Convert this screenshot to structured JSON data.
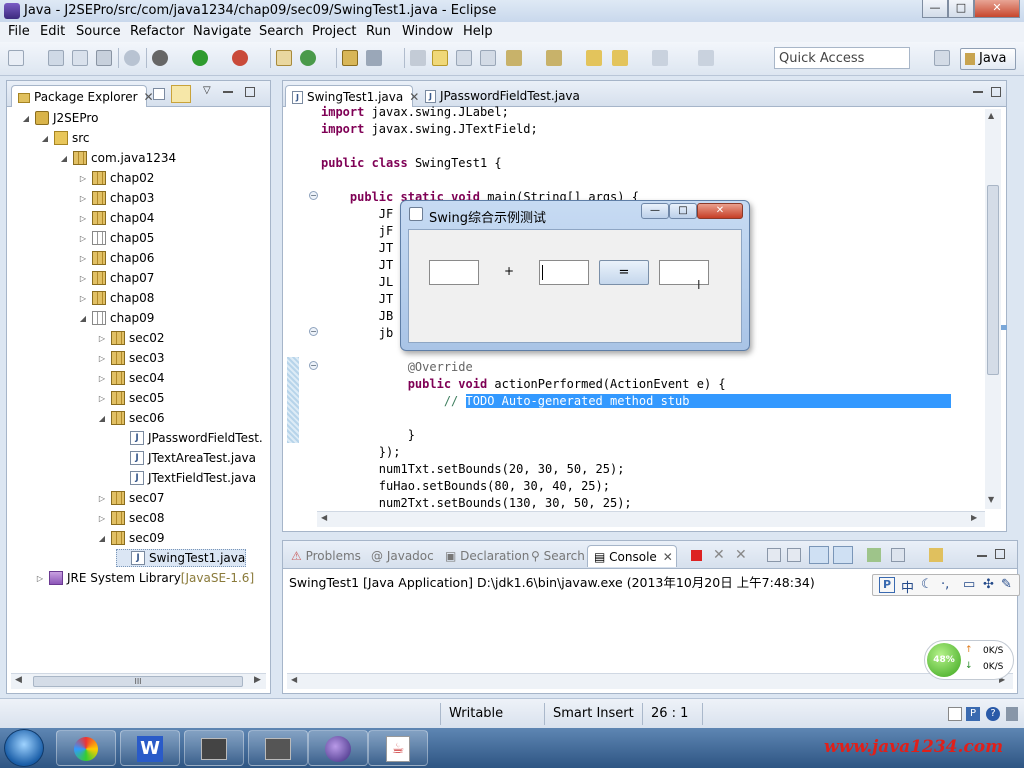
{
  "window": {
    "title": "Java - J2SEPro/src/com/java1234/chap09/sec09/SwingTest1.java - Eclipse",
    "min": "—",
    "max": "□",
    "close": "✕"
  },
  "menubar": [
    "File",
    "Edit",
    "Source",
    "Refactor",
    "Navigate",
    "Search",
    "Project",
    "Run",
    "Window",
    "Help"
  ],
  "toolbar": {
    "quick_access_placeholder": "Quick Access",
    "perspective": "Java"
  },
  "package_explorer": {
    "title": "Package Explorer",
    "tree": [
      {
        "label": "J2SEPro",
        "indent": 0,
        "icon": "project-icon",
        "expanded": true
      },
      {
        "label": "src",
        "indent": 1,
        "icon": "source-folder-icon",
        "expanded": true
      },
      {
        "label": "com.java1234",
        "indent": 2,
        "icon": "package-icon",
        "expanded": true
      },
      {
        "label": "chap02",
        "indent": 3,
        "icon": "package-icon",
        "expanded": false
      },
      {
        "label": "chap03",
        "indent": 3,
        "icon": "package-icon",
        "expanded": false
      },
      {
        "label": "chap04",
        "indent": 3,
        "icon": "package-icon",
        "expanded": false
      },
      {
        "label": "chap05",
        "indent": 3,
        "icon": "package-empty-icon",
        "expanded": false
      },
      {
        "label": "chap06",
        "indent": 3,
        "icon": "package-icon",
        "expanded": false
      },
      {
        "label": "chap07",
        "indent": 3,
        "icon": "package-icon",
        "expanded": false
      },
      {
        "label": "chap08",
        "indent": 3,
        "icon": "package-icon",
        "expanded": false
      },
      {
        "label": "chap09",
        "indent": 3,
        "icon": "package-empty-icon",
        "expanded": true
      },
      {
        "label": "sec02",
        "indent": 4,
        "icon": "package-icon",
        "expanded": false
      },
      {
        "label": "sec03",
        "indent": 4,
        "icon": "package-icon",
        "expanded": false
      },
      {
        "label": "sec04",
        "indent": 4,
        "icon": "package-icon",
        "expanded": false
      },
      {
        "label": "sec05",
        "indent": 4,
        "icon": "package-icon",
        "expanded": false
      },
      {
        "label": "sec06",
        "indent": 4,
        "icon": "package-icon",
        "expanded": true
      },
      {
        "label": "JPasswordFieldTest.",
        "indent": 5,
        "icon": "java-file-icon",
        "leaf": true
      },
      {
        "label": "JTextAreaTest.java",
        "indent": 5,
        "icon": "java-file-icon",
        "leaf": true
      },
      {
        "label": "JTextFieldTest.java",
        "indent": 5,
        "icon": "java-file-icon",
        "leaf": true
      },
      {
        "label": "sec07",
        "indent": 4,
        "icon": "package-icon",
        "expanded": false
      },
      {
        "label": "sec08",
        "indent": 4,
        "icon": "package-icon",
        "expanded": false
      },
      {
        "label": "sec09",
        "indent": 4,
        "icon": "package-icon",
        "expanded": true
      },
      {
        "label": "SwingTest1.java",
        "indent": 5,
        "icon": "java-file-icon",
        "leaf": true,
        "selected": true
      },
      {
        "label": "JRE System Library",
        "suffix": " [JavaSE-1.6]",
        "indent": 1,
        "icon": "library-icon",
        "expanded": false
      }
    ],
    "scroll_label": "III"
  },
  "editor": {
    "tabs": [
      "SwingTest1.java",
      "JPasswordFieldTest.java"
    ],
    "code_lines": [
      "import javax.swing.JLabel;",
      "import javax.swing.JTextField;",
      "",
      "public class SwingTest1 {",
      "",
      "    public static void main(String[] args) {",
      "        JF",
      "        jF",
      "        JT",
      "        JT",
      "        JL",
      "        JT",
      "        JB",
      "        jb",
      "",
      "            @Override",
      "            public void actionPerformed(ActionEvent e) {",
      "                // TODO Auto-generated method stub",
      "",
      "            }",
      "        });",
      "        num1Txt.setBounds(20, 30, 50, 25);",
      "        fuHao.setBounds(80, 30, 40, 25);",
      "        num2Txt.setBounds(130, 30, 50, 25);"
    ],
    "selected_text": "TODO Auto-generated method stub"
  },
  "swing_dialog": {
    "title": "Swing综合示例测试",
    "plus": "+",
    "equals": "="
  },
  "console": {
    "tabs": [
      "Problems",
      "Javadoc",
      "Declaration",
      "Search",
      "Console"
    ],
    "active_tab": "Console",
    "launch_line": "SwingTest1 [Java Application] D:\\jdk1.6\\bin\\javaw.exe (2013年10月20日 上午7:48:34)"
  },
  "statusbar": {
    "writable": "Writable",
    "insert_mode": "Smart Insert",
    "position": "26 : 1"
  },
  "net_widget": {
    "percent": "48%",
    "up": "0K/S",
    "down": "0K/S"
  },
  "ime": {
    "label": "中"
  },
  "watermark": "www.java1234.com"
}
